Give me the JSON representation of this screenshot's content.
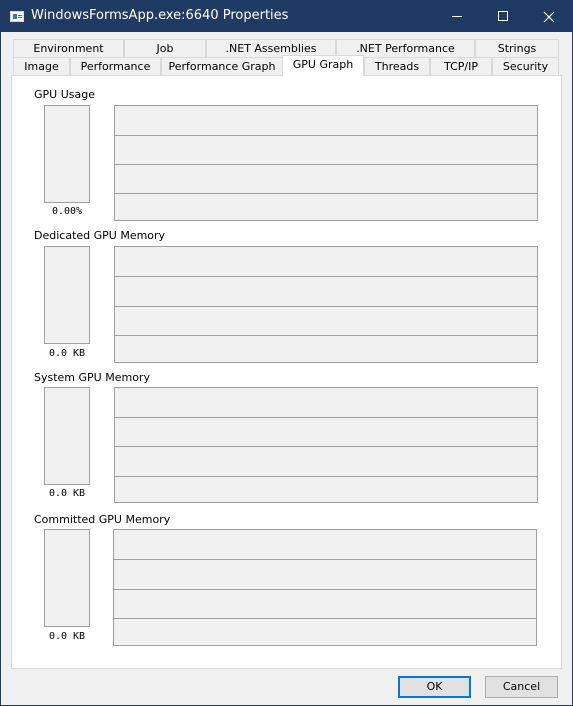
{
  "window": {
    "title": "WindowsFormsApp.exe:6640 Properties",
    "accent_color": "#1f3b63"
  },
  "tabs": {
    "row1": [
      "Environment",
      "Job",
      ".NET Assemblies",
      ".NET Performance",
      "Strings"
    ],
    "row2": [
      "Image",
      "Performance",
      "Performance Graph",
      "GPU Graph",
      "Threads",
      "TCP/IP",
      "Security"
    ],
    "selected": "GPU Graph"
  },
  "sections": [
    {
      "label": "GPU Usage",
      "value": "0.00%"
    },
    {
      "label": "Dedicated GPU Memory",
      "value": "0.0 KB"
    },
    {
      "label": "System GPU Memory",
      "value": "0.0 KB"
    },
    {
      "label": "Committed GPU Memory",
      "value": "0.0 KB"
    }
  ],
  "buttons": {
    "ok": "OK",
    "cancel": "Cancel"
  }
}
